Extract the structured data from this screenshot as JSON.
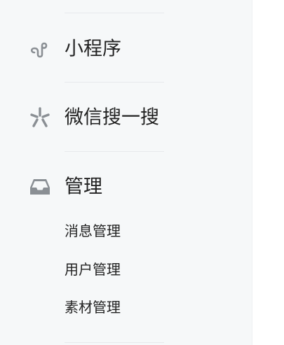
{
  "sidebar": {
    "sections": [
      {
        "icon": "mini-program-icon",
        "label": "小程序"
      },
      {
        "icon": "wechat-search-icon",
        "label": "微信搜一搜"
      },
      {
        "icon": "inbox-tray-icon",
        "label": "管理"
      }
    ],
    "manage_subitems": [
      {
        "label": "消息管理"
      },
      {
        "label": "用户管理"
      },
      {
        "label": "素材管理"
      }
    ]
  },
  "colors": {
    "sidebar_bg": "#f6f8f9",
    "text": "#222222",
    "icon": "#8a8f94",
    "divider": "#e7e9ec"
  }
}
